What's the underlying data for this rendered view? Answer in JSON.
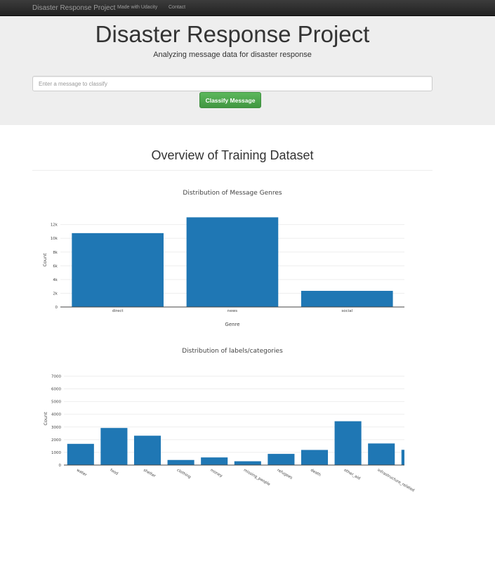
{
  "nav": {
    "brand": "Disaster Response Project",
    "links": [
      "Made with Udacity",
      "Contact"
    ]
  },
  "header": {
    "title": "Disaster Response Project",
    "subtitle": "Analyzing message data for disaster response"
  },
  "classifier": {
    "placeholder": "Enter a message to classify",
    "button_label": "Classify Message"
  },
  "section": {
    "title": "Overview of Training Dataset"
  },
  "colors": {
    "bar": "#1f77b4",
    "grid": "#eeeeee",
    "axis": "#444444",
    "button": "#5cb85c"
  },
  "chart_data": [
    {
      "type": "bar",
      "title": "Distribution of Message Genres",
      "xlabel": "Genre",
      "ylabel": "Count",
      "categories": [
        "direct",
        "news",
        "social"
      ],
      "values": [
        10750,
        13050,
        2350
      ],
      "ylim": [
        0,
        13700
      ],
      "yticks": [
        0,
        2000,
        4000,
        6000,
        8000,
        10000,
        12000
      ],
      "yticklabels": [
        "0",
        "2k",
        "4k",
        "6k",
        "8k",
        "10k",
        "12k"
      ],
      "grid": true
    },
    {
      "type": "bar",
      "title": "Distribution of labels/categories",
      "xlabel": "",
      "ylabel": "Count",
      "categories": [
        "water",
        "food",
        "shelter",
        "clothing",
        "money",
        "missing_people",
        "refugees",
        "death",
        "other_aid",
        "infrastructure_related",
        ""
      ],
      "values": [
        1670,
        2920,
        2310,
        400,
        600,
        300,
        880,
        1190,
        3450,
        1700,
        1200
      ],
      "ylim": [
        0,
        7300
      ],
      "yticks": [
        0,
        1000,
        2000,
        3000,
        4000,
        5000,
        6000,
        7000
      ],
      "yticklabels": [
        "0",
        "1000",
        "2000",
        "3000",
        "4000",
        "5000",
        "6000",
        "7000"
      ],
      "grid": true
    }
  ]
}
